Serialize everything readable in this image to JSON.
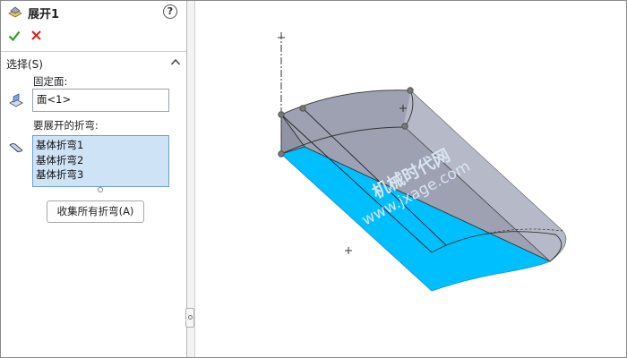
{
  "panel": {
    "title": "展开1",
    "help": "?",
    "selection_group": {
      "title": "选择(S)",
      "fixed_face_label": "固定面:",
      "fixed_face_value": "面<1>",
      "bends_label": "要展开的折弯:",
      "bends": [
        "基体折弯1",
        "基体折弯2",
        "基体折弯3"
      ],
      "collect_button": "收集所有折弯(A)"
    },
    "icons": {
      "feature": "unfold-feature-icon",
      "ok": "checkmark-icon",
      "cancel": "x-icon",
      "collapse": "chevron-up-icon",
      "face": "face-selection-icon",
      "bend": "bend-selection-icon"
    }
  },
  "graphics": {
    "watermark_cn": "机械时代网",
    "watermark_en": "www.jxage.com"
  },
  "colors": {
    "accent_check": "#2e9b2e",
    "cancel_red": "#d42020",
    "fixed_face_blue": "#00bfff",
    "sheet_gray": "#9da1b2",
    "list_selection": "#cfe3f7"
  }
}
